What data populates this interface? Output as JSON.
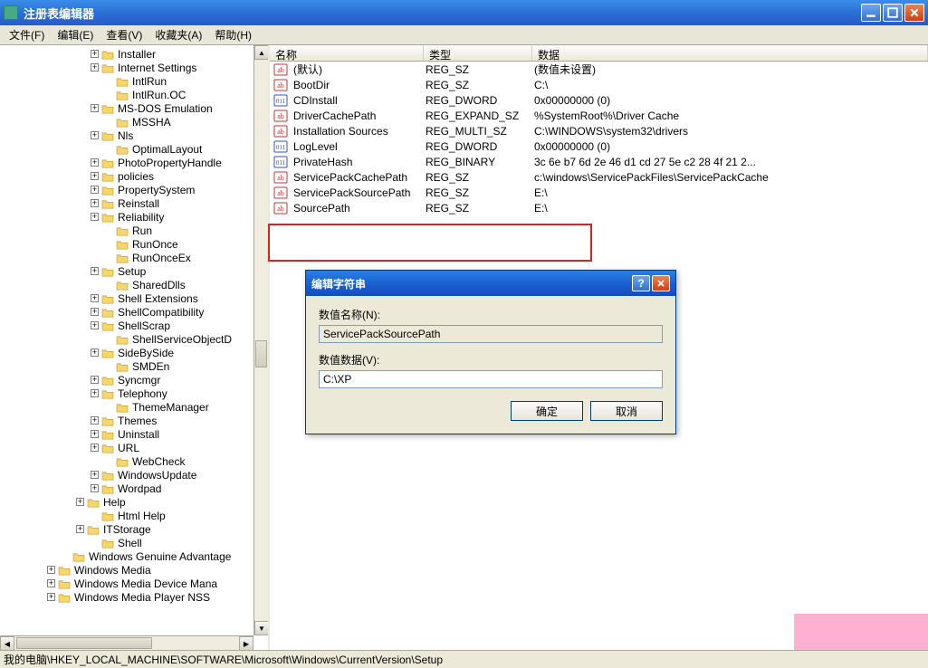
{
  "window": {
    "title": "注册表编辑器"
  },
  "menu": [
    {
      "label": "文件(F)"
    },
    {
      "label": "编辑(E)"
    },
    {
      "label": "查看(V)"
    },
    {
      "label": "收藏夹(A)"
    },
    {
      "label": "帮助(H)"
    }
  ],
  "tree": {
    "indent_base": 100,
    "items": [
      {
        "label": "Installer",
        "expander": "+",
        "depth": 0
      },
      {
        "label": "Internet Settings",
        "expander": "+",
        "depth": 0
      },
      {
        "label": "IntlRun",
        "expander": "",
        "depth": 1
      },
      {
        "label": "IntlRun.OC",
        "expander": "",
        "depth": 1
      },
      {
        "label": "MS-DOS Emulation",
        "expander": "+",
        "depth": 0
      },
      {
        "label": "MSSHA",
        "expander": "",
        "depth": 1
      },
      {
        "label": "Nls",
        "expander": "+",
        "depth": 0
      },
      {
        "label": "OptimalLayout",
        "expander": "",
        "depth": 1
      },
      {
        "label": "PhotoPropertyHandle",
        "expander": "+",
        "depth": 0
      },
      {
        "label": "policies",
        "expander": "+",
        "depth": 0
      },
      {
        "label": "PropertySystem",
        "expander": "+",
        "depth": 0
      },
      {
        "label": "Reinstall",
        "expander": "+",
        "depth": 0
      },
      {
        "label": "Reliability",
        "expander": "+",
        "depth": 0
      },
      {
        "label": "Run",
        "expander": "",
        "depth": 1
      },
      {
        "label": "RunOnce",
        "expander": "",
        "depth": 1
      },
      {
        "label": "RunOnceEx",
        "expander": "",
        "depth": 1
      },
      {
        "label": "Setup",
        "expander": "+",
        "depth": 0
      },
      {
        "label": "SharedDlls",
        "expander": "",
        "depth": 1
      },
      {
        "label": "Shell Extensions",
        "expander": "+",
        "depth": 0
      },
      {
        "label": "ShellCompatibility",
        "expander": "+",
        "depth": 0
      },
      {
        "label": "ShellScrap",
        "expander": "+",
        "depth": 0
      },
      {
        "label": "ShellServiceObjectD",
        "expander": "",
        "depth": 1
      },
      {
        "label": "SideBySide",
        "expander": "+",
        "depth": 0
      },
      {
        "label": "SMDEn",
        "expander": "",
        "depth": 1
      },
      {
        "label": "Syncmgr",
        "expander": "+",
        "depth": 0
      },
      {
        "label": "Telephony",
        "expander": "+",
        "depth": 0
      },
      {
        "label": "ThemeManager",
        "expander": "",
        "depth": 1
      },
      {
        "label": "Themes",
        "expander": "+",
        "depth": 0
      },
      {
        "label": "Uninstall",
        "expander": "+",
        "depth": 0
      },
      {
        "label": "URL",
        "expander": "+",
        "depth": 0
      },
      {
        "label": "WebCheck",
        "expander": "",
        "depth": 1
      },
      {
        "label": "WindowsUpdate",
        "expander": "+",
        "depth": 0
      },
      {
        "label": "Wordpad",
        "expander": "+",
        "depth": 0
      },
      {
        "label": "Help",
        "expander": "+",
        "depth": -1
      },
      {
        "label": "Html Help",
        "expander": "",
        "depth": 0
      },
      {
        "label": "ITStorage",
        "expander": "+",
        "depth": -1
      },
      {
        "label": "Shell",
        "expander": "",
        "depth": 0
      },
      {
        "label": "Windows Genuine Advantage",
        "expander": "",
        "depth": -2
      },
      {
        "label": "Windows Media",
        "expander": "+",
        "depth": -3
      },
      {
        "label": "Windows Media Device Mana",
        "expander": "+",
        "depth": -3
      },
      {
        "label": "Windows Media Player NSS",
        "expander": "+",
        "depth": -3
      }
    ]
  },
  "columns": {
    "name": "名称",
    "type": "类型",
    "data": "数据"
  },
  "values": [
    {
      "icon": "str",
      "name": "(默认)",
      "type": "REG_SZ",
      "data": "(数值未设置)"
    },
    {
      "icon": "str",
      "name": "BootDir",
      "type": "REG_SZ",
      "data": "C:\\"
    },
    {
      "icon": "bin",
      "name": "CDInstall",
      "type": "REG_DWORD",
      "data": "0x00000000 (0)"
    },
    {
      "icon": "str",
      "name": "DriverCachePath",
      "type": "REG_EXPAND_SZ",
      "data": "%SystemRoot%\\Driver Cache"
    },
    {
      "icon": "str",
      "name": "Installation Sources",
      "type": "REG_MULTI_SZ",
      "data": "C:\\WINDOWS\\system32\\drivers"
    },
    {
      "icon": "bin",
      "name": "LogLevel",
      "type": "REG_DWORD",
      "data": "0x00000000 (0)"
    },
    {
      "icon": "bin",
      "name": "PrivateHash",
      "type": "REG_BINARY",
      "data": "3c 6e b7 6d 2e 46 d1 cd 27 5e c2 28 4f 21 2..."
    },
    {
      "icon": "str",
      "name": "ServicePackCachePath",
      "type": "REG_SZ",
      "data": "c:\\windows\\ServicePackFiles\\ServicePackCache"
    },
    {
      "icon": "str",
      "name": "ServicePackSourcePath",
      "type": "REG_SZ",
      "data": "E:\\"
    },
    {
      "icon": "str",
      "name": "SourcePath",
      "type": "REG_SZ",
      "data": "E:\\"
    }
  ],
  "dialog": {
    "title": "编辑字符串",
    "name_label": "数值名称(N):",
    "name_value": "ServicePackSourcePath",
    "data_label": "数值数据(V):",
    "data_value": "C:\\XP",
    "ok": "确定",
    "cancel": "取消"
  },
  "statusbar": "我的电脑\\HKEY_LOCAL_MACHINE\\SOFTWARE\\Microsoft\\Windows\\CurrentVersion\\Setup"
}
